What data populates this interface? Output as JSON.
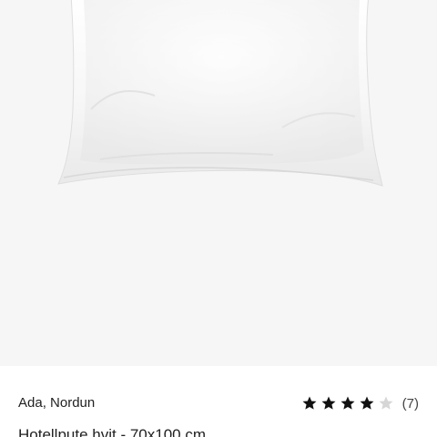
{
  "product": {
    "image_alt": "White pillow",
    "brand": "Ada, Nordun",
    "title": "Hotellpute hvit - 70x100 cm",
    "rating": {
      "stars_filled": 4,
      "stars_total": 5,
      "count_label": "(7)"
    }
  },
  "colors": {
    "background": "#f6f6f6",
    "panel": "#ffffff",
    "star_filled": "#111111",
    "star_empty": "#d6d6d6"
  },
  "icons": {
    "star": "star-icon"
  }
}
